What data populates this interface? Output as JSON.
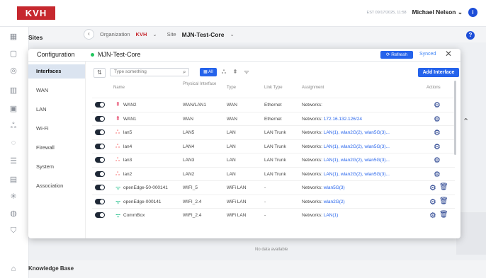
{
  "topbar": {
    "logo": "KVH",
    "date": "EST 09/17/2025, 11:58",
    "user": "Michael Nelson",
    "info": "i"
  },
  "sidebar": {
    "sites_label": "Sites",
    "knowledge_base": "Knowledge Base"
  },
  "breadcrumb": {
    "org_label": "Organization",
    "org_value": "KVH",
    "site_label": "Site",
    "site_value": "MJN-Test-Core"
  },
  "background": {
    "no_data": "No data available"
  },
  "modal": {
    "config_title": "Configuration",
    "site_name": "MJN-Test-Core",
    "refresh_label": "Refresh",
    "synced_label": "Synced",
    "close": "✕",
    "nav": [
      "Interfaces",
      "WAN",
      "LAN",
      "Wi-Fi",
      "Firewall",
      "System",
      "Association"
    ],
    "active_nav": "Interfaces",
    "search_placeholder": "Type something",
    "filter_all": "All",
    "add_interface": "Add Interface",
    "columns": [
      "Name",
      "Physical Interface",
      "Type",
      "Link Type",
      "Assignment",
      "Actions"
    ],
    "rows": [
      {
        "type_icon": "wan-icon",
        "name": "WAN2",
        "physical": "WAN/LAN1",
        "type": "WAN",
        "link": "Ethernet",
        "assignment_prefix": "Networks:",
        "assignment_value": "",
        "deletable": false
      },
      {
        "type_icon": "wan-icon",
        "name": "WAN1",
        "physical": "WAN",
        "type": "WAN",
        "link": "Ethernet",
        "assignment_prefix": "Networks:",
        "assignment_value": "172.16.132.126/24",
        "deletable": false
      },
      {
        "type_icon": "lan-icon",
        "name": "lan5",
        "physical": "LAN5",
        "type": "LAN",
        "link": "LAN Trunk",
        "assignment_prefix": "Networks:",
        "assignment_value": "LAN(1), wlan2G(2), wlan5G(3)...",
        "deletable": false
      },
      {
        "type_icon": "lan-icon",
        "name": "lan4",
        "physical": "LAN4",
        "type": "LAN",
        "link": "LAN Trunk",
        "assignment_prefix": "Networks:",
        "assignment_value": "LAN(1), wlan2G(2), wlan5G(3)...",
        "deletable": false
      },
      {
        "type_icon": "lan-icon",
        "name": "lan3",
        "physical": "LAN3",
        "type": "LAN",
        "link": "LAN Trunk",
        "assignment_prefix": "Networks:",
        "assignment_value": "LAN(1), wlan2G(2), wlan5G(3)...",
        "deletable": false
      },
      {
        "type_icon": "lan-icon",
        "name": "lan2",
        "physical": "LAN2",
        "type": "LAN",
        "link": "LAN Trunk",
        "assignment_prefix": "Networks:",
        "assignment_value": "LAN(1), wlan2G(2), wlan5G(3)...",
        "deletable": false
      },
      {
        "type_icon": "wifi-icon",
        "name": "openEdge-50-000141",
        "physical": "WIFI_5",
        "type": "WiFi LAN",
        "link": "-",
        "assignment_prefix": "Networks:",
        "assignment_value": "wlan5G(3)",
        "deletable": true
      },
      {
        "type_icon": "wifi-icon",
        "name": "openEdge-000141",
        "physical": "WIFI_2.4",
        "type": "WiFi LAN",
        "link": "-",
        "assignment_prefix": "Networks:",
        "assignment_value": "wlan2G(2)",
        "deletable": true
      },
      {
        "type_icon": "wifi-icon",
        "name": "CommBox",
        "physical": "WIFI_2.4",
        "type": "WiFi LAN",
        "link": "-",
        "assignment_prefix": "Networks:",
        "assignment_value": "LAN(1)",
        "deletable": true
      }
    ]
  },
  "colors": {
    "brand": "#c6282e",
    "accent": "#2563eb",
    "wan": "#e11d48",
    "lan": "#f87171",
    "wifi": "#10b981"
  }
}
